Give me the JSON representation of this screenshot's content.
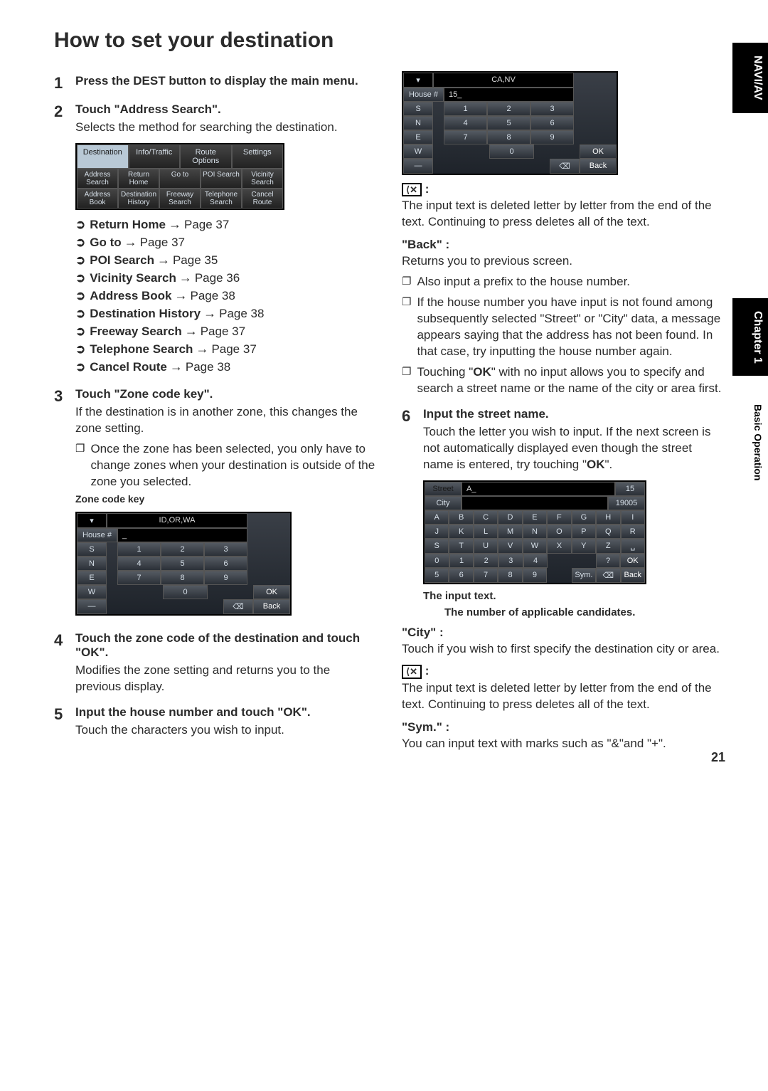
{
  "page_number": "21",
  "side": {
    "tab1": "NAVI/AV",
    "chapter": "Chapter 1",
    "sub": "Basic Operation"
  },
  "title": "How to set your destination",
  "left": {
    "step1": {
      "head": "Press the DEST button to display the main menu."
    },
    "step2": {
      "head": "Touch \"Address Search\".",
      "desc": "Selects the method for searching the destination."
    },
    "screen1": {
      "tabs": [
        "Destination",
        "Info/Traffic",
        "Route Options",
        "Settings"
      ],
      "row1": [
        "Address Search",
        "Return Home",
        "Go to",
        "POI Search",
        "Vicinity Search"
      ],
      "row2": [
        "Address Book",
        "Destination History",
        "Freeway Search",
        "Telephone Search",
        "Cancel Route"
      ]
    },
    "links": [
      {
        "bold": "Return Home",
        "page": "Page 37"
      },
      {
        "bold": "Go to",
        "page": "Page 37"
      },
      {
        "bold": "POI Search",
        "page": "Page 35"
      },
      {
        "bold": "Vicinity Search",
        "page": "Page 36"
      },
      {
        "bold": "Address Book",
        "page": "Page 38"
      },
      {
        "bold": "Destination History",
        "page": "Page 38"
      },
      {
        "bold": "Freeway Search",
        "page": "Page 37"
      },
      {
        "bold": "Telephone Search",
        "page": "Page 37"
      },
      {
        "bold": "Cancel Route",
        "page": "Page 38"
      }
    ],
    "step3": {
      "head": "Touch \"Zone code key\".",
      "desc": "If the destination is in another zone, this changes the zone setting.",
      "bullet": "Once the zone has been selected, you only have to change zones when your destination is outside of the zone you selected.",
      "caption": "Zone code key"
    },
    "screen2": {
      "zone": "ID,OR,WA",
      "label_house": "House #",
      "left_keys": [
        "S",
        "N",
        "E",
        "W",
        "—"
      ],
      "num_rows": [
        [
          "1",
          "2",
          "3"
        ],
        [
          "4",
          "5",
          "6"
        ],
        [
          "7",
          "8",
          "9"
        ],
        [
          "",
          "0",
          ""
        ]
      ],
      "ok": "OK",
      "back": "Back",
      "del": "⌫"
    },
    "step4": {
      "head": "Touch the zone code of the destination and touch \"OK\".",
      "desc": "Modifies the zone setting and returns you to the previous display."
    },
    "step5": {
      "head": "Input the house number and touch \"OK\".",
      "desc": "Touch the characters you wish to input."
    }
  },
  "right": {
    "screen3": {
      "zone": "CA,NV",
      "label_house": "House #",
      "house_val": "15_",
      "left_keys": [
        "S",
        "N",
        "E",
        "W",
        "—"
      ],
      "num_rows": [
        [
          "1",
          "2",
          "3"
        ],
        [
          "4",
          "5",
          "6"
        ],
        [
          "7",
          "8",
          "9"
        ],
        [
          "",
          "0",
          ""
        ]
      ],
      "ok": "OK",
      "back": "Back",
      "del": "⌫"
    },
    "del_label": ":",
    "del_desc": "The input text is deleted letter by letter from the end of the text. Continuing to press deletes all of the text.",
    "back_head": "\"Back\" :",
    "back_desc": "Returns you to previous screen.",
    "bullets": [
      "Also input a prefix to the house number.",
      "If the house number you have input is not found among subsequently selected \"Street\" or \"City\" data, a message appears saying that the address has not been found. In that case, try inputting the house number again.",
      "Touching \"OK\" with no input allows you to specify and search a street name or the name of the city or area first."
    ],
    "ok_inline": "OK",
    "step6": {
      "head": "Input the street name.",
      "desc": "Touch the letter you wish to input. If the next screen is not automatically displayed even though the street name is entered, try touching \"OK\"."
    },
    "screen4": {
      "street": "Street",
      "city": "City",
      "street_val": "A_",
      "count1": "15",
      "count2": "19005",
      "rows": [
        [
          "A",
          "B",
          "C",
          "D",
          "E",
          "F",
          "G",
          "H",
          "I"
        ],
        [
          "J",
          "K",
          "L",
          "M",
          "N",
          "O",
          "P",
          "Q",
          "R"
        ],
        [
          "S",
          "T",
          "U",
          "V",
          "W",
          "X",
          "Y",
          "Z",
          "␣"
        ],
        [
          "0",
          "1",
          "2",
          "3",
          "4",
          "",
          "",
          "?",
          "OK"
        ],
        [
          "5",
          "6",
          "7",
          "8",
          "9",
          "",
          "Sym.",
          "⌫",
          "Back"
        ]
      ]
    },
    "annot1": "The input text.",
    "annot2": "The number of applicable candidates.",
    "city_head": "\"City\" :",
    "city_desc": "Touch if you wish to first specify the destination city or area.",
    "del2_desc": "The input text is deleted letter by letter from the end of the text. Continuing to press deletes all of the text.",
    "sym_head": "\"Sym.\" :",
    "sym_desc": "You can input text with marks such as \"&\"and \"+\"."
  }
}
